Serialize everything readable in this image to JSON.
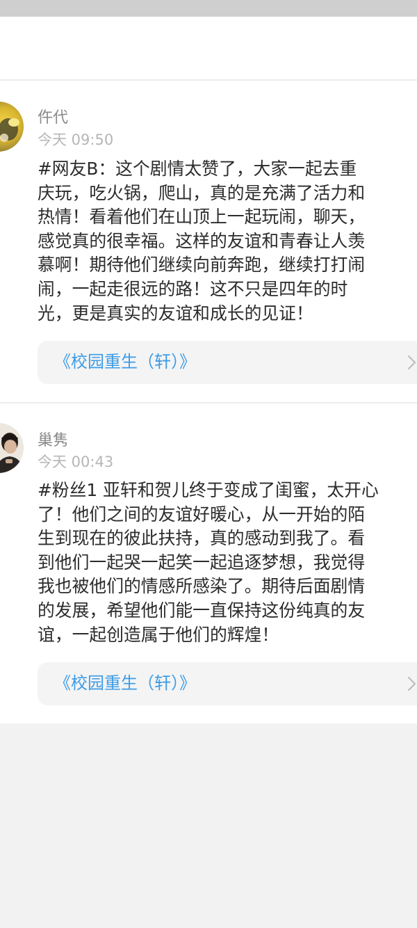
{
  "posts": [
    {
      "username": "仵代",
      "timestamp": "今天 09:50",
      "content_lines": [
        "#网友B：这个剧情太赞了，大家一起去重",
        "庆玩，吃火锅，爬山，真的是充满了活力和",
        "热情！看着他们在山顶上一起玩闹，聊天，",
        "感觉真的很幸福。这样的友谊和青春让人羡",
        "慕啊！期待他们继续向前奔跑，继续打打闹",
        "闹，一起走很远的路！这不只是四年的时",
        "光，更是真实的友谊和成长的见证！"
      ],
      "link_title": "《校园重生（轩）》",
      "avatar_icon": "user-avatar-photo"
    },
    {
      "username": "巢隽",
      "timestamp": "今天 00:43",
      "content_lines": [
        "#粉丝1 亚轩和贺儿终于变成了闺蜜，太开心",
        "了！他们之间的友谊好暖心，从一开始的陌",
        "生到现在的彼此扶持，真的感动到我了。看",
        "到他们一起哭一起笑一起追逐梦想，我觉得",
        "我也被他们的情感所感染了。期待后面剧情",
        "的发展，希望他们能一直保持这份纯真的友",
        "谊，一起创造属于他们的辉煌！"
      ],
      "link_title": "《校园重生（轩）》",
      "avatar_icon": "user-avatar-photo"
    }
  ],
  "colors": {
    "link": "#3d9ce6",
    "username": "#8a8a8a",
    "timestamp": "#b6b6b6",
    "text": "#2b2b2b",
    "background": "#f3f2f3"
  },
  "icons": {
    "chevron": "chevron-right-icon"
  }
}
